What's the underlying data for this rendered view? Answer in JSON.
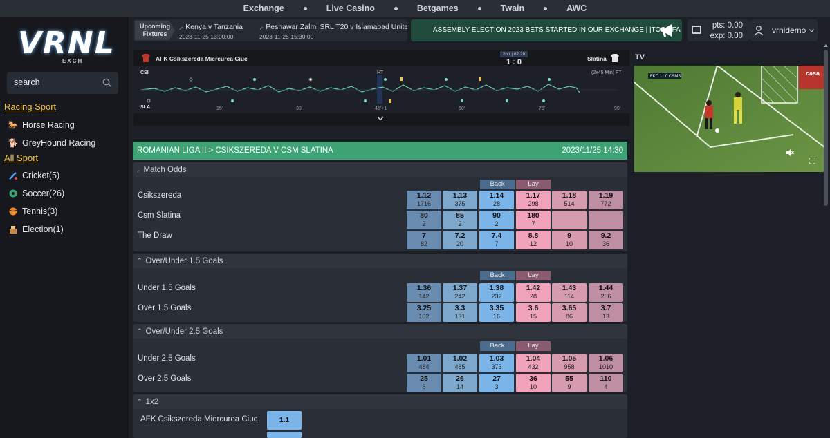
{
  "nav": {
    "items": [
      "Exchange",
      "Live Casino",
      "Betgames",
      "Twain",
      "AWC"
    ]
  },
  "sidebar": {
    "logo_text": "VRNL",
    "logo_sub": "EXCH",
    "search_placeholder": "search",
    "racing_title": "Racing Sport",
    "racing_items": [
      {
        "label": "Horse Racing",
        "icon": "horse-icon"
      },
      {
        "label": "GreyHound Racing",
        "icon": "greyhound-icon"
      }
    ],
    "all_sport_title": "All Sport",
    "sport_items": [
      {
        "label": "Cricket(5)",
        "icon": "cricket-icon"
      },
      {
        "label": "Soccer(26)",
        "icon": "soccer-icon"
      },
      {
        "label": "Tennis(3)",
        "icon": "tennis-icon"
      },
      {
        "label": "Election(1)",
        "icon": "election-icon"
      }
    ]
  },
  "fixtures": {
    "label_line1": "Upcoming",
    "label_line2": "Fixtures",
    "items": [
      {
        "name": "Kenya v Tanzania",
        "date": "2023-11-25 13:00:00"
      },
      {
        "name": "Peshawar Zalmi SRL T20 v Islamabad Unite",
        "date": "2023-11-25 15:30:00"
      }
    ]
  },
  "marquee": {
    "text": "ASSEMBLY ELECTION 2023 BETS STARTED IN OUR EXCHANGE | |TOSS FA"
  },
  "wallet": {
    "pts": "pts: 0.00",
    "exp": "exp: 0.00"
  },
  "user": {
    "name": "vrnldemo"
  },
  "timeline": {
    "home": "AFK Csikszereda Miercurea Ciuc",
    "away": "Slatina",
    "period": "2nd | 82:20",
    "score": "1 : 0",
    "home_short": "CSI",
    "away_short": "SLA",
    "ht": "HT",
    "format": "(2x45 Min) FT",
    "ticks": [
      "15'",
      "30'",
      "45'+1",
      "60'",
      "75'",
      "90'"
    ]
  },
  "event": {
    "title": "ROMANIAN LIGA II > CSIKSZEREDA V CSM SLATINA",
    "datetime": "2023/11/25 14:30"
  },
  "labels": {
    "back": "Back",
    "lay": "Lay"
  },
  "markets": [
    {
      "name": "Match Odds",
      "runners": [
        {
          "name": "Csikszereda",
          "odds": [
            [
              "1.12",
              "1716"
            ],
            [
              "1.13",
              "375"
            ],
            [
              "1.14",
              "28"
            ],
            [
              "1.17",
              "298"
            ],
            [
              "1.18",
              "514"
            ],
            [
              "1.19",
              "772"
            ]
          ]
        },
        {
          "name": "Csm Slatina",
          "odds": [
            [
              "80",
              "2"
            ],
            [
              "85",
              "2"
            ],
            [
              "90",
              "2"
            ],
            [
              "180",
              "7"
            ],
            [
              "",
              ""
            ],
            [
              "",
              ""
            ]
          ]
        },
        {
          "name": "The Draw",
          "odds": [
            [
              "7",
              "82"
            ],
            [
              "7.2",
              "20"
            ],
            [
              "7.4",
              "7"
            ],
            [
              "8.8",
              "12"
            ],
            [
              "9",
              "10"
            ],
            [
              "9.2",
              "36"
            ]
          ]
        }
      ]
    },
    {
      "name": "Over/Under 1.5 Goals",
      "runners": [
        {
          "name": "Under 1.5 Goals",
          "odds": [
            [
              "1.36",
              "142"
            ],
            [
              "1.37",
              "242"
            ],
            [
              "1.38",
              "232"
            ],
            [
              "1.42",
              "28"
            ],
            [
              "1.43",
              "114"
            ],
            [
              "1.44",
              "256"
            ]
          ]
        },
        {
          "name": "Over 1.5 Goals",
          "odds": [
            [
              "3.25",
              "102"
            ],
            [
              "3.3",
              "131"
            ],
            [
              "3.35",
              "16"
            ],
            [
              "3.6",
              "15"
            ],
            [
              "3.65",
              "86"
            ],
            [
              "3.7",
              "13"
            ]
          ]
        }
      ]
    },
    {
      "name": "Over/Under 2.5 Goals",
      "runners": [
        {
          "name": "Under 2.5 Goals",
          "odds": [
            [
              "1.01",
              "484"
            ],
            [
              "1.02",
              "485"
            ],
            [
              "1.03",
              "373"
            ],
            [
              "1.04",
              "432"
            ],
            [
              "1.05",
              "958"
            ],
            [
              "1.06",
              "1010"
            ]
          ]
        },
        {
          "name": "Over 2.5 Goals",
          "odds": [
            [
              "25",
              "6"
            ],
            [
              "26",
              "14"
            ],
            [
              "27",
              "3"
            ],
            [
              "36",
              "10"
            ],
            [
              "55",
              "9"
            ],
            [
              "110",
              "4"
            ]
          ]
        }
      ]
    },
    {
      "name": "1x2",
      "runners": [
        {
          "name": "AFK Csikszereda Miercurea Ciuc",
          "odds": [
            [
              "1.1",
              ""
            ]
          ]
        }
      ]
    }
  ],
  "tv": {
    "label": "TV",
    "score_overlay": "FKC 1 : 0 CSMS",
    "ad_text": "casa"
  },
  "colors": {
    "event_bar": "#3ea374",
    "back_best": "#7bb4e8",
    "lay_best": "#f0a2bb",
    "accent_yellow": "#f5c542"
  }
}
